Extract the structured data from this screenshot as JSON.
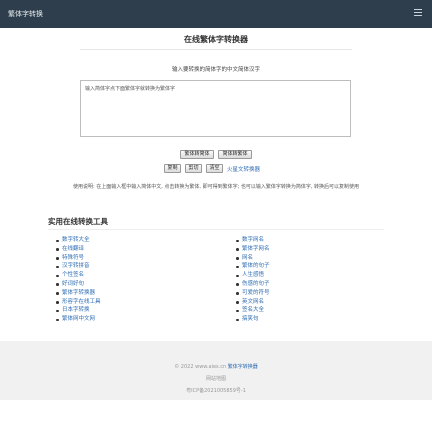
{
  "navbar": {
    "brand": "繁体字转换",
    "menu_icon": "hamburger-menu-icon"
  },
  "main": {
    "title": "在线繁体字转换器",
    "prompt": "输入要转换的简体字的中文简体汉字",
    "textarea_value": "输入简体字点下面繁体字就转换为繁体字"
  },
  "buttons": {
    "to_simplified": "繁体转简体",
    "to_traditional": "简体转繁体",
    "copy": "复制",
    "cut": "剪切",
    "clear": "清空",
    "mars_link": "火星文转换器"
  },
  "help_text": "使用说明: 在上面输入框中输入简体中文, 点击转换为繁体, 即可得到繁体字; 也可以输入繁体字转换为简体字, 转换后可以复制使用",
  "tools": {
    "heading": "实用在线转换工具",
    "left": [
      "数字转大全",
      "在线翻译",
      "特殊符号",
      "汉字转拼音",
      "个性签名",
      "好词好句",
      "繁体字转换器",
      "形容字在线工具",
      "日本字转换",
      "繁体网中文网"
    ],
    "right": [
      "数字网名",
      "繁体字网名",
      "网名",
      "繁体的句子",
      "人生感悟",
      "伤感的句子",
      "可爱的符号",
      "英文网名",
      "签名大全",
      "搞笑句"
    ]
  },
  "footer": {
    "copyright_prefix": "© 2022 www.aies.cn ",
    "copyright_link": "繁体字转换器",
    "sitemap": "网站地图",
    "icp": "粤ICP备2021005859号-1"
  },
  "colors": {
    "navbar": "#2f3e4c",
    "link": "#2d6bb3",
    "footer": "#f1f1f1"
  }
}
